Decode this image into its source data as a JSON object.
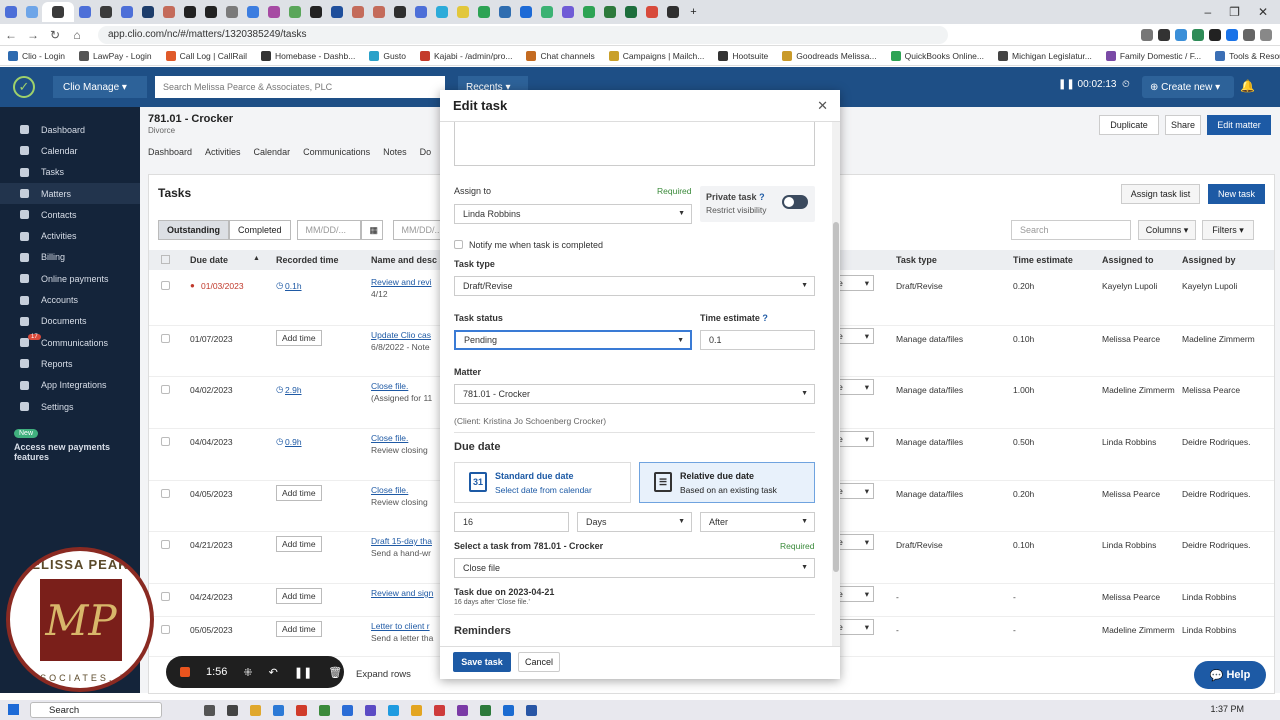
{
  "browser": {
    "url": "app.clio.com/nc/#/matters/1320385249/tasks",
    "bookmarks": [
      "Clio - Login",
      "LawPay - Login",
      "Call Log | CallRail",
      "Homebase - Dashb...",
      "Gusto",
      "Kajabi - /admin/pro...",
      "Chat channels",
      "Campaigns | Mailch...",
      "Hootsuite",
      "Goodreads Melissa...",
      "QuickBooks Online...",
      "Michigan Legislatur...",
      "Family Domestic / F...",
      "Tools & Resources..."
    ],
    "tab_colors": [
      "#4d6fd8",
      "#6ea5e8",
      "#3b3b3b",
      "#4d6fd8",
      "#3b3b3b",
      "#4d6fd8",
      "#1d3d6b",
      "#c46b5a",
      "#222222",
      "#222222",
      "#7a7a7a",
      "#3c7de0",
      "#a64aa3",
      "#5aa65a",
      "#222222",
      "#1f4f9c",
      "#c46b5a",
      "#c46b5a",
      "#2f2f2f",
      "#4d6fd8",
      "#2cabd9",
      "#e2c73b",
      "#2da354",
      "#2f6db0",
      "#1d6ad6",
      "#3bb273",
      "#6f5bd6",
      "#2da354",
      "#2d7a3b",
      "#1d6e3c",
      "#d84a3b",
      "#2f2f2f"
    ]
  },
  "clio": {
    "app_name": "Clio Manage",
    "search_placeholder": "Search Melissa Pearce & Associates, PLC",
    "recents": "Recents",
    "timer": "00:02:13",
    "create_new": "Create new"
  },
  "sidebar": {
    "items": [
      "Dashboard",
      "Calendar",
      "Tasks",
      "Matters",
      "Contacts",
      "Activities",
      "Billing",
      "Online payments",
      "Accounts",
      "Documents",
      "Communications",
      "Reports",
      "App Integrations",
      "Settings"
    ],
    "comm_badge": "17",
    "promo_badge": "New",
    "promo_text": "Access new payments features"
  },
  "matter": {
    "title": "781.01 - Crocker",
    "subtitle": "Divorce",
    "buttons": [
      "Duplicate",
      "Share",
      "Edit matter"
    ],
    "tabs": [
      "Dashboard",
      "Activities",
      "Calendar",
      "Communications",
      "Notes",
      "Do"
    ]
  },
  "tasks": {
    "heading": "Tasks",
    "assign_list": "Assign task list",
    "new_task": "New task",
    "tab_outstanding": "Outstanding",
    "tab_completed": "Completed",
    "date_placeholder": "MM/DD/...",
    "search_placeholder": "Search",
    "columns_label": "Columns",
    "filters_label": "Filters",
    "headers": {
      "due_date": "Due date",
      "recorded_time": "Recorded time",
      "name": "Name and desc",
      "task_type": "Task type",
      "time_estimate": "Time estimate",
      "assigned_to": "Assigned to",
      "assigned_by": "Assigned by"
    },
    "rows": [
      {
        "due": "01/03/2023",
        "recorded": "0.1h",
        "name": "Review and revi",
        "desc": "4/12",
        "complete": "ete",
        "type": "Draft/Revise",
        "estimate": "0.20h",
        "to": "Kayelyn Lupoli",
        "by": "Kayelyn Lupoli",
        "overdue": true
      },
      {
        "due": "01/07/2023",
        "recorded": "Add time",
        "name": "Update Clio cas",
        "desc": "6/8/2022 - Note",
        "complete": "ete",
        "type": "Manage data/files",
        "estimate": "0.10h",
        "to": "Melissa Pearce",
        "by": "Madeline Zimmerm",
        "overdue": false
      },
      {
        "due": "04/02/2023",
        "recorded": "2.9h",
        "name": "Close file.",
        "desc": "(Assigned for 11",
        "complete": "ete",
        "type": "Manage data/files",
        "estimate": "1.00h",
        "to": "Madeline Zimmerm",
        "by": "Melissa Pearce",
        "overdue": false
      },
      {
        "due": "04/04/2023",
        "recorded": "0.9h",
        "name": "Close file.",
        "desc": "Review closing",
        "complete": "ete",
        "type": "Manage data/files",
        "estimate": "0.50h",
        "to": "Linda Robbins",
        "by": "Deidre Rodriques.",
        "overdue": false
      },
      {
        "due": "04/05/2023",
        "recorded": "Add time",
        "name": "Close file.",
        "desc": "Review closing",
        "complete": "ete",
        "type": "Manage data/files",
        "estimate": "0.20h",
        "to": "Melissa Pearce",
        "by": "Deidre Rodriques.",
        "overdue": false
      },
      {
        "due": "04/21/2023",
        "recorded": "Add time",
        "name": "Draft 15-day tha",
        "desc": "Send a hand-wr",
        "complete": "ete",
        "type": "Draft/Revise",
        "estimate": "0.10h",
        "to": "Linda Robbins",
        "by": "Deidre Rodriques.",
        "overdue": false
      },
      {
        "due": "04/24/2023",
        "recorded": "Add time",
        "name": "Review and sign",
        "desc": "",
        "complete": "ete",
        "type": "-",
        "estimate": "-",
        "to": "Melissa Pearce",
        "by": "Linda Robbins",
        "overdue": false
      },
      {
        "due": "05/05/2023",
        "recorded": "Add time",
        "name": "Letter to client r",
        "desc": "Send a letter tha",
        "complete": "ete",
        "type": "-",
        "estimate": "-",
        "to": "Madeline Zimmerm",
        "by": "Linda Robbins",
        "overdue": false
      }
    ],
    "expand_rows": "Expand rows"
  },
  "modal": {
    "title": "Edit task",
    "assign_to_label": "Assign to",
    "required": "Required",
    "assign_to_value": "Linda Robbins",
    "private_title": "Private task",
    "private_sub": "Restrict visibility",
    "notify_label": "Notify me when task is completed",
    "task_type_label": "Task type",
    "task_type_value": "Draft/Revise",
    "task_status_label": "Task status",
    "task_status_value": "Pending",
    "time_estimate_label": "Time estimate",
    "time_estimate_value": "0.1",
    "matter_label": "Matter",
    "matter_value": "781.01 - Crocker",
    "client_note": "(Client: Kristina Jo Schoenberg Crocker)",
    "due_date_heading": "Due date",
    "standard_title": "Standard due date",
    "standard_sub": "Select date from calendar",
    "relative_title": "Relative due date",
    "relative_sub": "Based on an existing task",
    "cal_day": "31",
    "offset_value": "16",
    "unit_value": "Days",
    "direction_value": "After",
    "select_task_label": "Select a task from 781.01 - Crocker",
    "select_task_value": "Close file",
    "due_on": "Task due on 2023-04-21",
    "due_on_sub": "16 days after 'Close file.'",
    "reminders_heading": "Reminders",
    "save": "Save task",
    "cancel": "Cancel"
  },
  "overlay": {
    "logo_top": "ELISSA PEAR",
    "logo_mark": "MP",
    "logo_bottom": "SSOCIATES, P",
    "recording_time": "1:56",
    "help": "Help"
  },
  "taskbar": {
    "search": "Search",
    "time": "1:37 PM",
    "icon_colors": [
      "#555555",
      "#444444",
      "#e0a82e",
      "#2d7ad6",
      "#d03b2a",
      "#3b8a3b",
      "#2a6cd6",
      "#5b4bc4",
      "#1f9be0",
      "#e3a521",
      "#ce3b3b",
      "#7b3aa6",
      "#2d7a3b",
      "#1b6bd1",
      "#2855a5"
    ]
  },
  "colors": {
    "brand": "#1e4f86",
    "sidebar": "#14243a",
    "accent": "#1d5aa5",
    "required": "#3a8a3a"
  }
}
